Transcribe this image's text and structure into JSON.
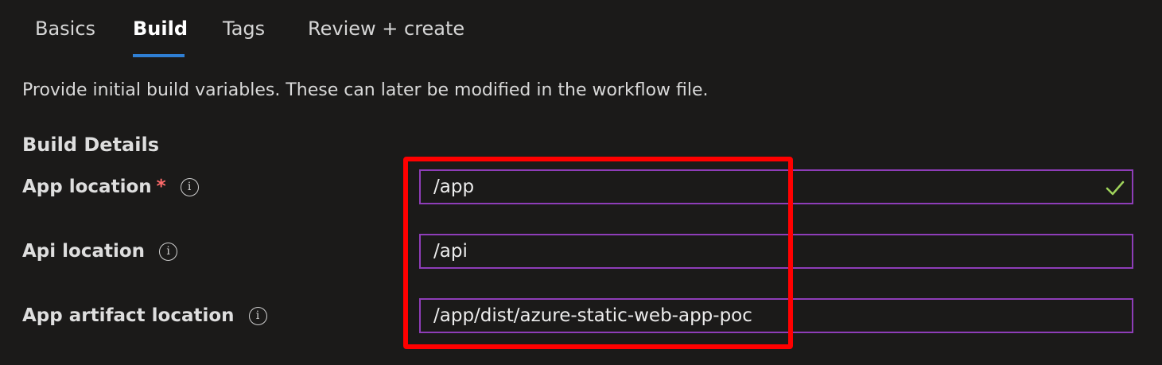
{
  "tabs": [
    {
      "label": "Basics",
      "active": false
    },
    {
      "label": "Build",
      "active": true
    },
    {
      "label": "Tags",
      "active": false
    },
    {
      "label": "Review + create",
      "active": false
    }
  ],
  "description": "Provide initial build variables. These can later be modified in the workflow file.",
  "section_title": "Build Details",
  "fields": [
    {
      "label": "App location",
      "required_mark": "*",
      "value": "/app",
      "valid": true
    },
    {
      "label": "Api location",
      "value": "/api"
    },
    {
      "label": "App artifact location",
      "value": "/app/dist/azure-static-web-app-poc"
    }
  ],
  "icons": {
    "info": "info-icon",
    "valid": "checkmark-icon"
  },
  "colors": {
    "background": "#1b1a19",
    "accent_tab": "#2f7fd4",
    "input_border": "#8e3db8",
    "valid_check": "#9fd35b",
    "required_star": "#ff6b6b",
    "highlight_annotation": "#ff0000"
  }
}
